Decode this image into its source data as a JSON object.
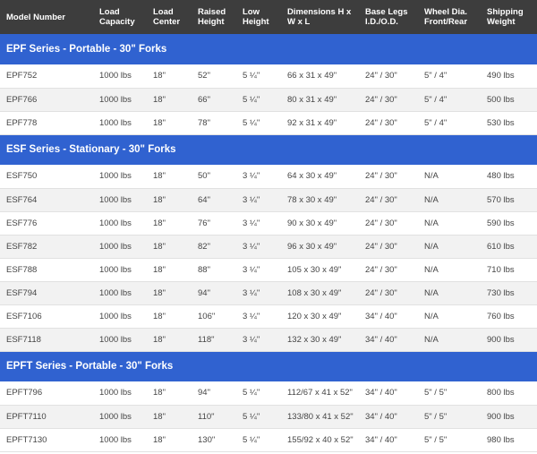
{
  "header": [
    "Model Number",
    "Load Capacity",
    "Load Center",
    "Raised Height",
    "Low Height",
    "Dimensions H x W x L",
    "Base Legs I.D./O.D.",
    "Wheel Dia. Front/Rear",
    "Shipping Weight"
  ],
  "sections": [
    {
      "title": "EPF Series - Portable - 30\" Forks",
      "rows": [
        [
          "EPF752",
          "1000 lbs",
          "18\"",
          "52\"",
          "5 ¼\"",
          "66 x 31 x 49\"",
          "24\" / 30\"",
          "5\" / 4\"",
          "490 lbs"
        ],
        [
          "EPF766",
          "1000 lbs",
          "18\"",
          "66\"",
          "5 ¼\"",
          "80 x 31 x 49\"",
          "24\" / 30\"",
          "5\" / 4\"",
          "500 lbs"
        ],
        [
          "EPF778",
          "1000 lbs",
          "18\"",
          "78\"",
          "5 ¼\"",
          "92 x 31 x 49\"",
          "24\" / 30\"",
          "5\" / 4\"",
          "530 lbs"
        ]
      ]
    },
    {
      "title": "ESF Series - Stationary - 30\" Forks",
      "rows": [
        [
          "ESF750",
          "1000 lbs",
          "18\"",
          "50\"",
          "3 ¼\"",
          "64 x 30 x 49\"",
          "24\" / 30\"",
          "N/A",
          "480 lbs"
        ],
        [
          "ESF764",
          "1000 lbs",
          "18\"",
          "64\"",
          "3 ¼\"",
          "78 x 30 x 49\"",
          "24\" / 30\"",
          "N/A",
          "570 lbs"
        ],
        [
          "ESF776",
          "1000 lbs",
          "18\"",
          "76\"",
          "3 ¼\"",
          "90 x 30 x 49\"",
          "24\" / 30\"",
          "N/A",
          "590 lbs"
        ],
        [
          "ESF782",
          "1000 lbs",
          "18\"",
          "82\"",
          "3 ¼\"",
          "96 x 30 x 49\"",
          "24\" / 30\"",
          "N/A",
          "610 lbs"
        ],
        [
          "ESF788",
          "1000 lbs",
          "18\"",
          "88\"",
          "3 ¼\"",
          "105 x 30 x 49\"",
          "24\" / 30\"",
          "N/A",
          "710 lbs"
        ],
        [
          "ESF794",
          "1000 lbs",
          "18\"",
          "94\"",
          "3 ¼\"",
          "108 x 30 x 49\"",
          "24\" / 30\"",
          "N/A",
          "730 lbs"
        ],
        [
          "ESF7106",
          "1000 lbs",
          "18\"",
          "106\"",
          "3 ¼\"",
          "120 x 30 x 49\"",
          "34\" / 40\"",
          "N/A",
          "760 lbs"
        ],
        [
          "ESF7118",
          "1000 lbs",
          "18\"",
          "118\"",
          "3 ¼\"",
          "132 x 30 x 49\"",
          "34\" / 40\"",
          "N/A",
          "900 lbs"
        ]
      ]
    },
    {
      "title": "EPFT Series - Portable - 30\" Forks",
      "rows": [
        [
          "EPFT796",
          "1000 lbs",
          "18\"",
          "94\"",
          "5 ¼\"",
          "112/67 x 41 x 52\"",
          "34\" / 40\"",
          "5\" / 5\"",
          "800 lbs"
        ],
        [
          "EPFT7110",
          "1000 lbs",
          "18\"",
          "110\"",
          "5 ¼\"",
          "133/80 x 41 x 52\"",
          "34\" / 40\"",
          "5\" / 5\"",
          "900 lbs"
        ],
        [
          "EPFT7130",
          "1000 lbs",
          "18\"",
          "130\"",
          "5 ¼\"",
          "155/92 x 40 x 52\"",
          "34\" / 40\"",
          "5\" / 5\"",
          "980 lbs"
        ]
      ]
    }
  ],
  "colors": {
    "header_bg": "#3d3d3d",
    "section_bg": "#3062d0",
    "alt_row_bg": "#f2f2f2",
    "text": "#444444"
  }
}
